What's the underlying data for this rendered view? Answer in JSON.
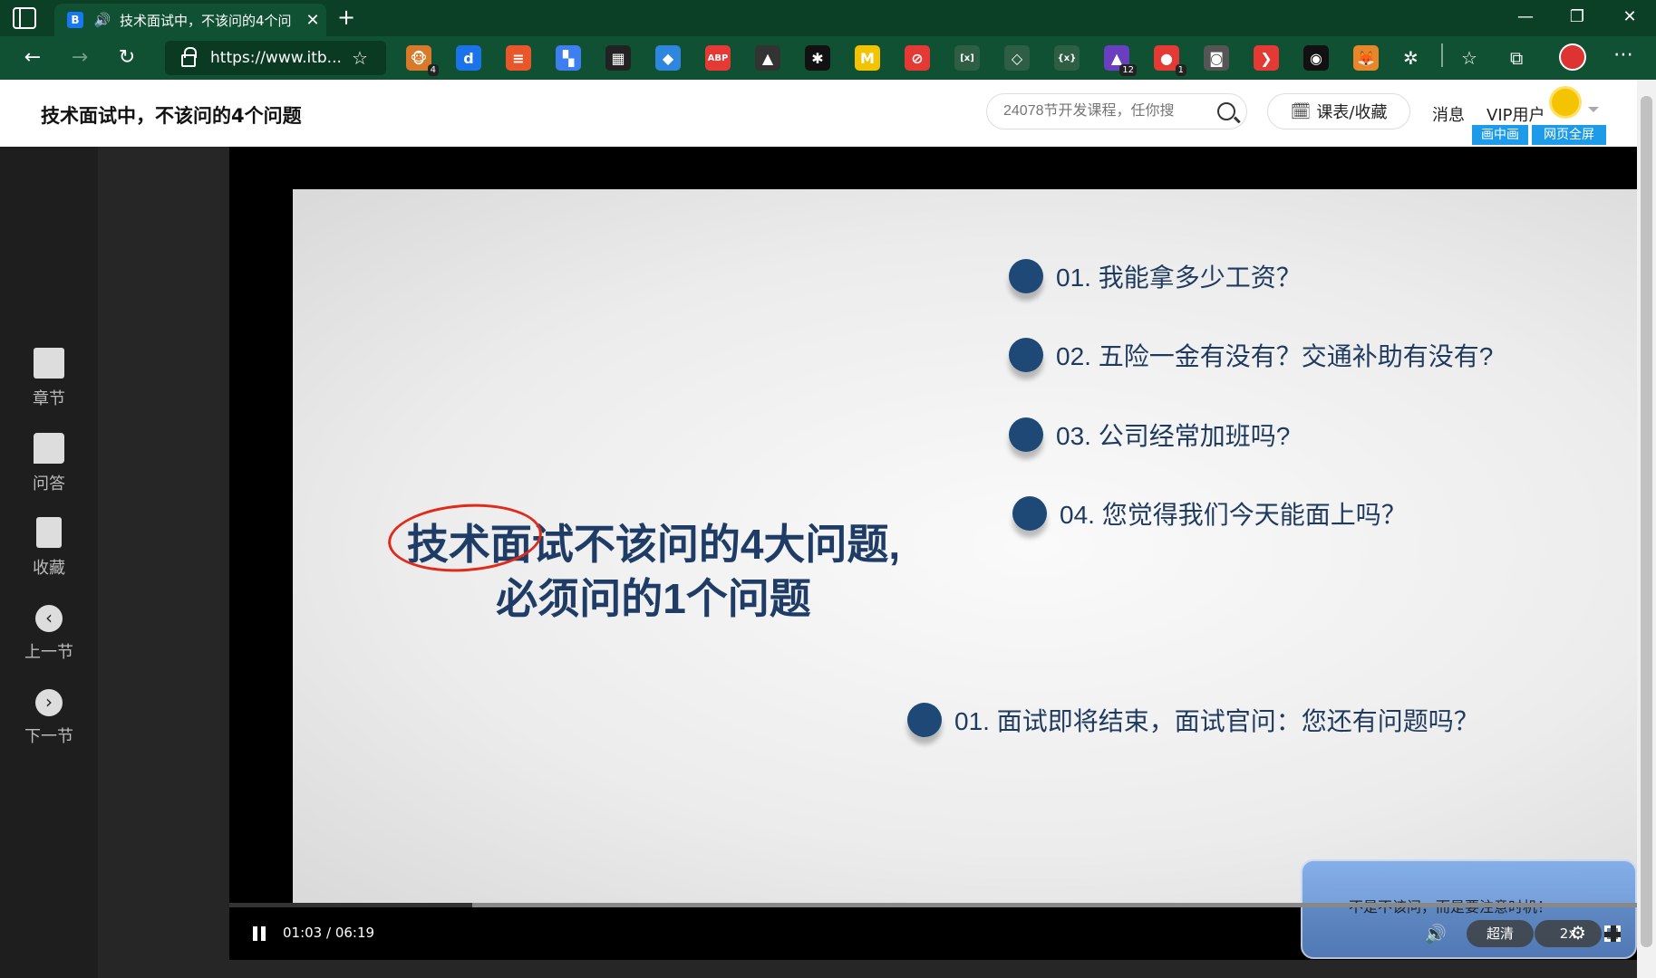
{
  "browser": {
    "tab_title": "技术面试中，不该问的4个问",
    "close_tab": "✕",
    "new_tab": "+",
    "url": "https://www.itb...",
    "extensions": [
      {
        "icon": "ext-monkey-icon",
        "badge": "4",
        "color": "#d97a2b",
        "glyph": "🐵"
      },
      {
        "icon": "ext-tiktok-icon",
        "badge": "",
        "color": "#1a73e8",
        "glyph": "d"
      },
      {
        "icon": "ext-notes-icon",
        "badge": "",
        "color": "#e8572a",
        "glyph": "≡"
      },
      {
        "icon": "ext-grid-icon",
        "badge": "",
        "color": "#3d7ef0",
        "glyph": "▚"
      },
      {
        "icon": "ext-calc-icon",
        "badge": "",
        "color": "#222222",
        "glyph": "▦"
      },
      {
        "icon": "ext-diamond-icon",
        "badge": "",
        "color": "#2e86de",
        "glyph": "◆"
      },
      {
        "icon": "ext-adblock-icon",
        "badge": "",
        "color": "#e53935",
        "glyph": "ABP"
      },
      {
        "icon": "ext-mountain-icon",
        "badge": "",
        "color": "#333333",
        "glyph": "▲"
      },
      {
        "icon": "ext-asterisk-icon",
        "badge": "",
        "color": "#111111",
        "glyph": "✱"
      },
      {
        "icon": "ext-m-icon",
        "badge": "",
        "color": "#f2c300",
        "glyph": "M"
      },
      {
        "icon": "ext-block-icon",
        "badge": "",
        "color": "#e53935",
        "glyph": "⊘"
      },
      {
        "icon": "ext-bracket-icon",
        "badge": "",
        "color": "#2e5e44",
        "glyph": "[x]"
      },
      {
        "icon": "ext-git-icon",
        "badge": "",
        "color": "#2e5e44",
        "glyph": "◇"
      },
      {
        "icon": "ext-code-icon",
        "badge": "",
        "color": "#2e5e44",
        "glyph": "{x}"
      },
      {
        "icon": "ext-hat-icon",
        "badge": "12",
        "color": "#6a3fbf",
        "glyph": "▲"
      },
      {
        "icon": "ext-mushroom-icon",
        "badge": "1",
        "color": "#e53935",
        "glyph": "●"
      },
      {
        "icon": "ext-camera-icon",
        "badge": "",
        "color": "#555555",
        "glyph": "◙"
      },
      {
        "icon": "ext-eye-icon",
        "badge": "",
        "color": "#e53935",
        "glyph": "❯"
      },
      {
        "icon": "ext-ring-icon",
        "badge": "",
        "color": "#111111",
        "glyph": "◉"
      },
      {
        "icon": "ext-fox-icon",
        "badge": "",
        "color": "#e8862a",
        "glyph": "🦊"
      }
    ]
  },
  "header": {
    "title": "技术面试中，不该问的4个问题",
    "search_placeholder": "24078节开发课程，任你搜",
    "schedule_button": "课表/收藏",
    "messages": "消息",
    "vip": "VIP用户",
    "pip_button": "画中画",
    "web_fullscreen_button": "网页全屏"
  },
  "sidebar": {
    "items": [
      {
        "label": "章节",
        "icon": "chapters-icon"
      },
      {
        "label": "问答",
        "icon": "qa-icon"
      },
      {
        "label": "收藏",
        "icon": "bookmark-icon"
      },
      {
        "label": "上一节",
        "icon": "prev-icon"
      },
      {
        "label": "下一节",
        "icon": "next-icon"
      }
    ]
  },
  "slide": {
    "title_line1": "技术面试不该问的4大问题,",
    "title_line2": "必须问的1个问题",
    "questions": [
      "01. 我能拿多少工资？",
      "02. 五险一金有没有？交通补助有没有?",
      "03. 公司经常加班吗?",
      "04. 您觉得我们今天能面上吗？"
    ],
    "must_ask": "01. 面试即将结束，面试官问：您还有问题吗？"
  },
  "player": {
    "danmu": "不是不该问，而是要注意时机！",
    "time": "01:03 / 06:19",
    "progress_fraction": 0.165,
    "quality": "超清",
    "speed": "2x"
  }
}
